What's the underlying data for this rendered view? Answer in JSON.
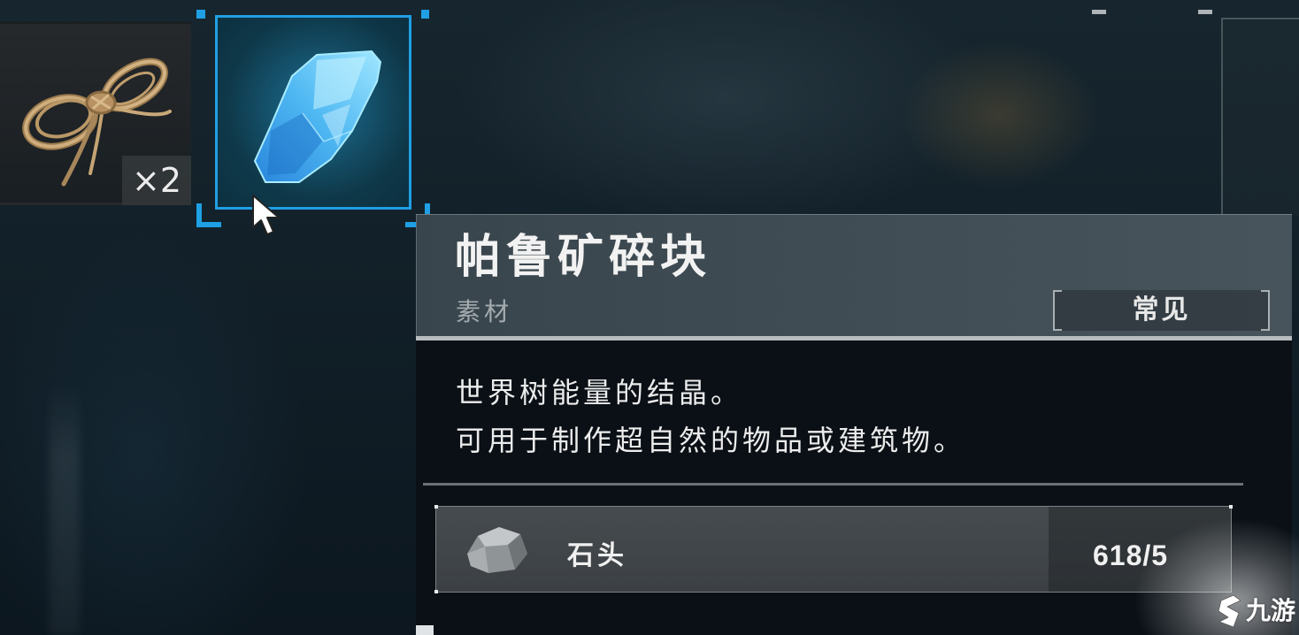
{
  "inventory": {
    "slots": [
      {
        "icon": "rope-icon",
        "count": "×2",
        "selected": false
      },
      {
        "icon": "paldium-fragment-icon",
        "selected": true
      }
    ]
  },
  "cursor": {
    "icon": "mouse-pointer-icon"
  },
  "tooltip": {
    "title": "帕鲁矿碎块",
    "category": "素材",
    "rarity": "常见",
    "description_lines": [
      "世界树能量的结晶。",
      "可用于制作超自然的物品或建筑物。"
    ],
    "materials": [
      {
        "icon": "stone-icon",
        "name": "石头",
        "quantity": "618/5"
      }
    ]
  },
  "watermark": {
    "icon": "jiuyou-logo-icon",
    "text": "九游"
  },
  "colors": {
    "selection_border": "#1f9fe4",
    "background": "#0d1920",
    "tooltip_header": "#3e4b53",
    "tooltip_body": "#0a1016",
    "material_row": "#3f4448",
    "text_primary": "#f2f2f2",
    "text_secondary": "#a3abaf"
  }
}
